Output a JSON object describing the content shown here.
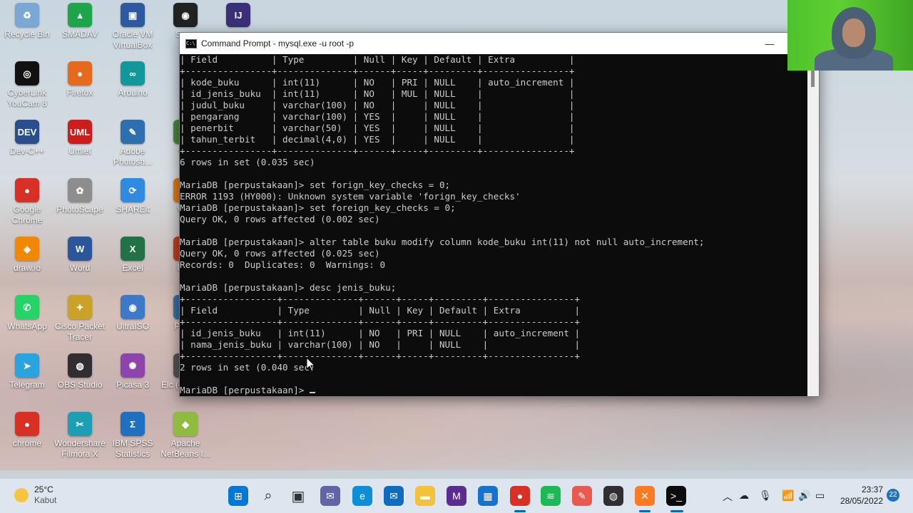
{
  "desktop": {
    "icons": [
      {
        "label": "Recycle Bin",
        "glyph": "♻",
        "color": "#7aa7d4",
        "icon": "recycle-bin-icon"
      },
      {
        "label": "SMADAV",
        "glyph": "▲",
        "color": "#1ea54a",
        "icon": "smadav-icon"
      },
      {
        "label": "Oracle VM VirtualBox",
        "glyph": "▣",
        "color": "#2d5a9e",
        "icon": "virtualbox-icon"
      },
      {
        "label": "Snag",
        "glyph": "◉",
        "color": "#222222",
        "icon": "snagit-icon"
      },
      {
        "label": "",
        "glyph": "IJ",
        "color": "#3b2f7a",
        "icon": "intellij-icon"
      },
      {
        "label": "CyberLink YouCam 8",
        "glyph": "◎",
        "color": "#111111",
        "icon": "youcam-icon"
      },
      {
        "label": "Firefox",
        "glyph": "●",
        "color": "#e66a1e",
        "icon": "firefox-icon"
      },
      {
        "label": "Arduino",
        "glyph": "∞",
        "color": "#12989b",
        "icon": "arduino-icon"
      },
      {
        "label": "Dev-C++",
        "glyph": "DEV",
        "color": "#2a4e8c",
        "icon": "devcpp-icon"
      },
      {
        "label": "Umlet",
        "glyph": "UML",
        "color": "#cc1c1c",
        "icon": "umlet-icon"
      },
      {
        "label": "Adobe Photosh...",
        "glyph": "✎",
        "color": "#2e6fb0",
        "icon": "photoshop-icon"
      },
      {
        "label": "Cor",
        "glyph": "✎",
        "color": "#4a8a3a",
        "icon": "cor-icon"
      },
      {
        "label": "Google Chrome",
        "glyph": "●",
        "color": "#d93025",
        "icon": "chrome-icon"
      },
      {
        "label": "PhotoScape",
        "glyph": "✿",
        "color": "#8d8d8d",
        "icon": "photoscape-icon"
      },
      {
        "label": "SHAREit",
        "glyph": "⟳",
        "color": "#2f8be0",
        "icon": "shareit-icon"
      },
      {
        "label": "VLC",
        "glyph": "▲",
        "color": "#e37b12",
        "icon": "vlc-icon"
      },
      {
        "label": "draw.io",
        "glyph": "◈",
        "color": "#f08705",
        "icon": "drawio-icon"
      },
      {
        "label": "Word",
        "glyph": "W",
        "color": "#2b579a",
        "icon": "word-icon"
      },
      {
        "label": "Excel",
        "glyph": "X",
        "color": "#217346",
        "icon": "excel-icon"
      },
      {
        "label": "Pow",
        "glyph": "P",
        "color": "#c43e1c",
        "icon": "powerpoint-icon"
      },
      {
        "label": "WhatsApp",
        "glyph": "✆",
        "color": "#25d366",
        "icon": "whatsapp-icon"
      },
      {
        "label": "Cisco Packet Tracer",
        "glyph": "✦",
        "color": "#c9a227",
        "icon": "packet-tracer-icon"
      },
      {
        "label": "UltraISO",
        "glyph": "◉",
        "color": "#3c79c9",
        "icon": "ultraiso-icon"
      },
      {
        "label": "Pyt (6",
        "glyph": "Py",
        "color": "#3572a5",
        "icon": "python-icon"
      },
      {
        "label": "Telegram",
        "glyph": "➤",
        "color": "#2aa3df",
        "icon": "telegram-icon"
      },
      {
        "label": "OBS Studio",
        "glyph": "◍",
        "color": "#302e31",
        "icon": "obs-icon"
      },
      {
        "label": "Picasa 3",
        "glyph": "✺",
        "color": "#8e44ad",
        "icon": "picasa-icon"
      },
      {
        "label": "Elc (elda) -...",
        "glyph": "E",
        "color": "#555555",
        "icon": "elc-icon"
      },
      {
        "label": "chrome",
        "glyph": "●",
        "color": "#d93025",
        "icon": "chrome-shortcut-icon"
      },
      {
        "label": "Wondershare Filmora X",
        "glyph": "✂",
        "color": "#1c9fb5",
        "icon": "filmora-icon"
      },
      {
        "label": "IBM SPSS Statistics",
        "glyph": "Σ",
        "color": "#1f70c1",
        "icon": "spss-icon"
      },
      {
        "label": "Apache NetBeans I...",
        "glyph": "◆",
        "color": "#8fbc3f",
        "icon": "netbeans-icon"
      }
    ]
  },
  "cmd": {
    "title": "Command Prompt - mysql.exe  -u root -p",
    "minimize": "—",
    "maximize": "☐",
    "lines": [
      "| Field          | Type         | Null | Key | Default | Extra          |",
      "+----------------+--------------+------+-----+---------+----------------+",
      "| kode_buku      | int(11)      | NO   | PRI | NULL    | auto_increment |",
      "| id_jenis_buku  | int(11)      | NO   | MUL | NULL    |                |",
      "| judul_buku     | varchar(100) | NO   |     | NULL    |                |",
      "| pengarang      | varchar(100) | YES  |     | NULL    |                |",
      "| penerbit       | varchar(50)  | YES  |     | NULL    |                |",
      "| tahun_terbit   | decimal(4,0) | YES  |     | NULL    |                |",
      "+----------------+--------------+------+-----+---------+----------------+",
      "6 rows in set (0.035 sec)",
      "",
      "MariaDB [perpustakaan]> set forign_key_checks = 0;",
      "ERROR 1193 (HY000): Unknown system variable 'forign_key_checks'",
      "MariaDB [perpustakaan]> set foreign_key_checks = 0;",
      "Query OK, 0 rows affected (0.002 sec)",
      "",
      "MariaDB [perpustakaan]> alter table buku modify column kode_buku int(11) not null auto_increment;",
      "Query OK, 0 rows affected (0.025 sec)",
      "Records: 0  Duplicates: 0  Warnings: 0",
      "",
      "MariaDB [perpustakaan]> desc jenis_buku;",
      "+-----------------+--------------+------+-----+---------+----------------+",
      "| Field           | Type         | Null | Key | Default | Extra          |",
      "+-----------------+--------------+------+-----+---------+----------------+",
      "| id_jenis_buku   | int(11)      | NO   | PRI | NULL    | auto_increment |",
      "| nama_jenis_buku | varchar(100) | NO   |     | NULL    |                |",
      "+-----------------+--------------+------+-----+---------+----------------+",
      "2 rows in set (0.040 sec)",
      ""
    ],
    "prompt": "MariaDB [perpustakaan]> "
  },
  "taskbar": {
    "weather_temp": "25°C",
    "weather_desc": "Kabut",
    "time": "23:37",
    "date": "28/05/2022",
    "notifications": "22",
    "pinned": [
      {
        "icon": "start-icon",
        "glyph": "⊞",
        "color": "#0078d4"
      },
      {
        "icon": "search-icon",
        "glyph": "⌕",
        "color": "#333333"
      },
      {
        "icon": "task-view-icon",
        "glyph": "▣",
        "color": "#333333"
      },
      {
        "icon": "chat-icon",
        "glyph": "✉",
        "color": "#6264a7"
      },
      {
        "icon": "edge-icon",
        "glyph": "e",
        "color": "#0c8fd6"
      },
      {
        "icon": "mail-icon",
        "glyph": "✉",
        "color": "#0f6cbd"
      },
      {
        "icon": "file-explorer-icon",
        "glyph": "▬",
        "color": "#f3c13a"
      },
      {
        "icon": "visual-studio-icon",
        "glyph": "M",
        "color": "#5c2d91"
      },
      {
        "icon": "store-icon",
        "glyph": "▦",
        "color": "#1573d0"
      },
      {
        "icon": "chrome-taskbar-icon",
        "glyph": "●",
        "color": "#d93025"
      },
      {
        "icon": "spotify-icon",
        "glyph": "≋",
        "color": "#1db954"
      },
      {
        "icon": "paint-icon",
        "glyph": "✎",
        "color": "#e85a4f"
      },
      {
        "icon": "obs-taskbar-icon",
        "glyph": "◍",
        "color": "#302e31"
      },
      {
        "icon": "xampp-icon",
        "glyph": "✕",
        "color": "#fb7a24"
      },
      {
        "icon": "cmd-taskbar-icon",
        "glyph": ">_",
        "color": "#0c0c0c"
      }
    ]
  }
}
